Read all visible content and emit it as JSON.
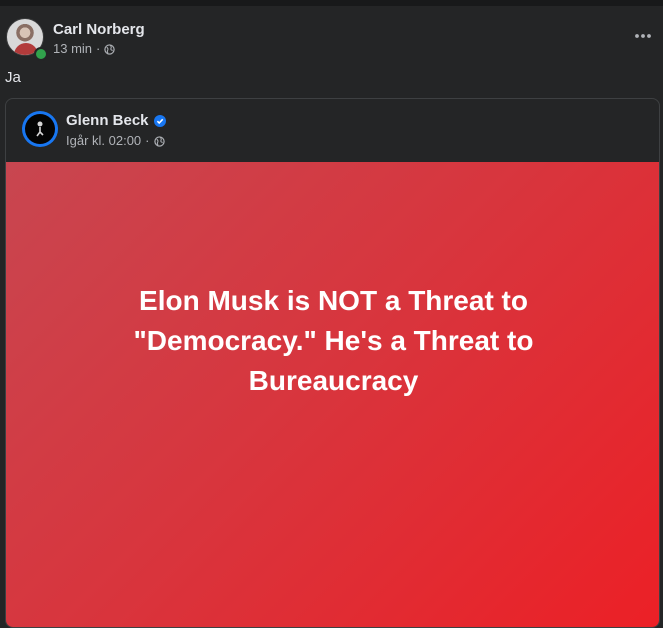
{
  "post": {
    "author": "Carl Norberg",
    "time": "13 min",
    "separator": "·",
    "privacy_icon": "globe-icon",
    "more_icon": "ellipsis-icon",
    "text": "Ja"
  },
  "shared_post": {
    "author": "Glenn Beck",
    "verified_icon": "verified-badge-icon",
    "time": "Igår kl. 02:00",
    "separator": "·",
    "privacy_icon": "globe-icon",
    "image_text": "Elon Musk is NOT a Threat to \"Democracy.\" He's a Threat to Bureaucracy"
  },
  "colors": {
    "background": "#242526",
    "card_red_start": "#c84650",
    "card_red_end": "#ec2026",
    "verified_blue": "#1877f2",
    "online_green": "#31a24c"
  }
}
